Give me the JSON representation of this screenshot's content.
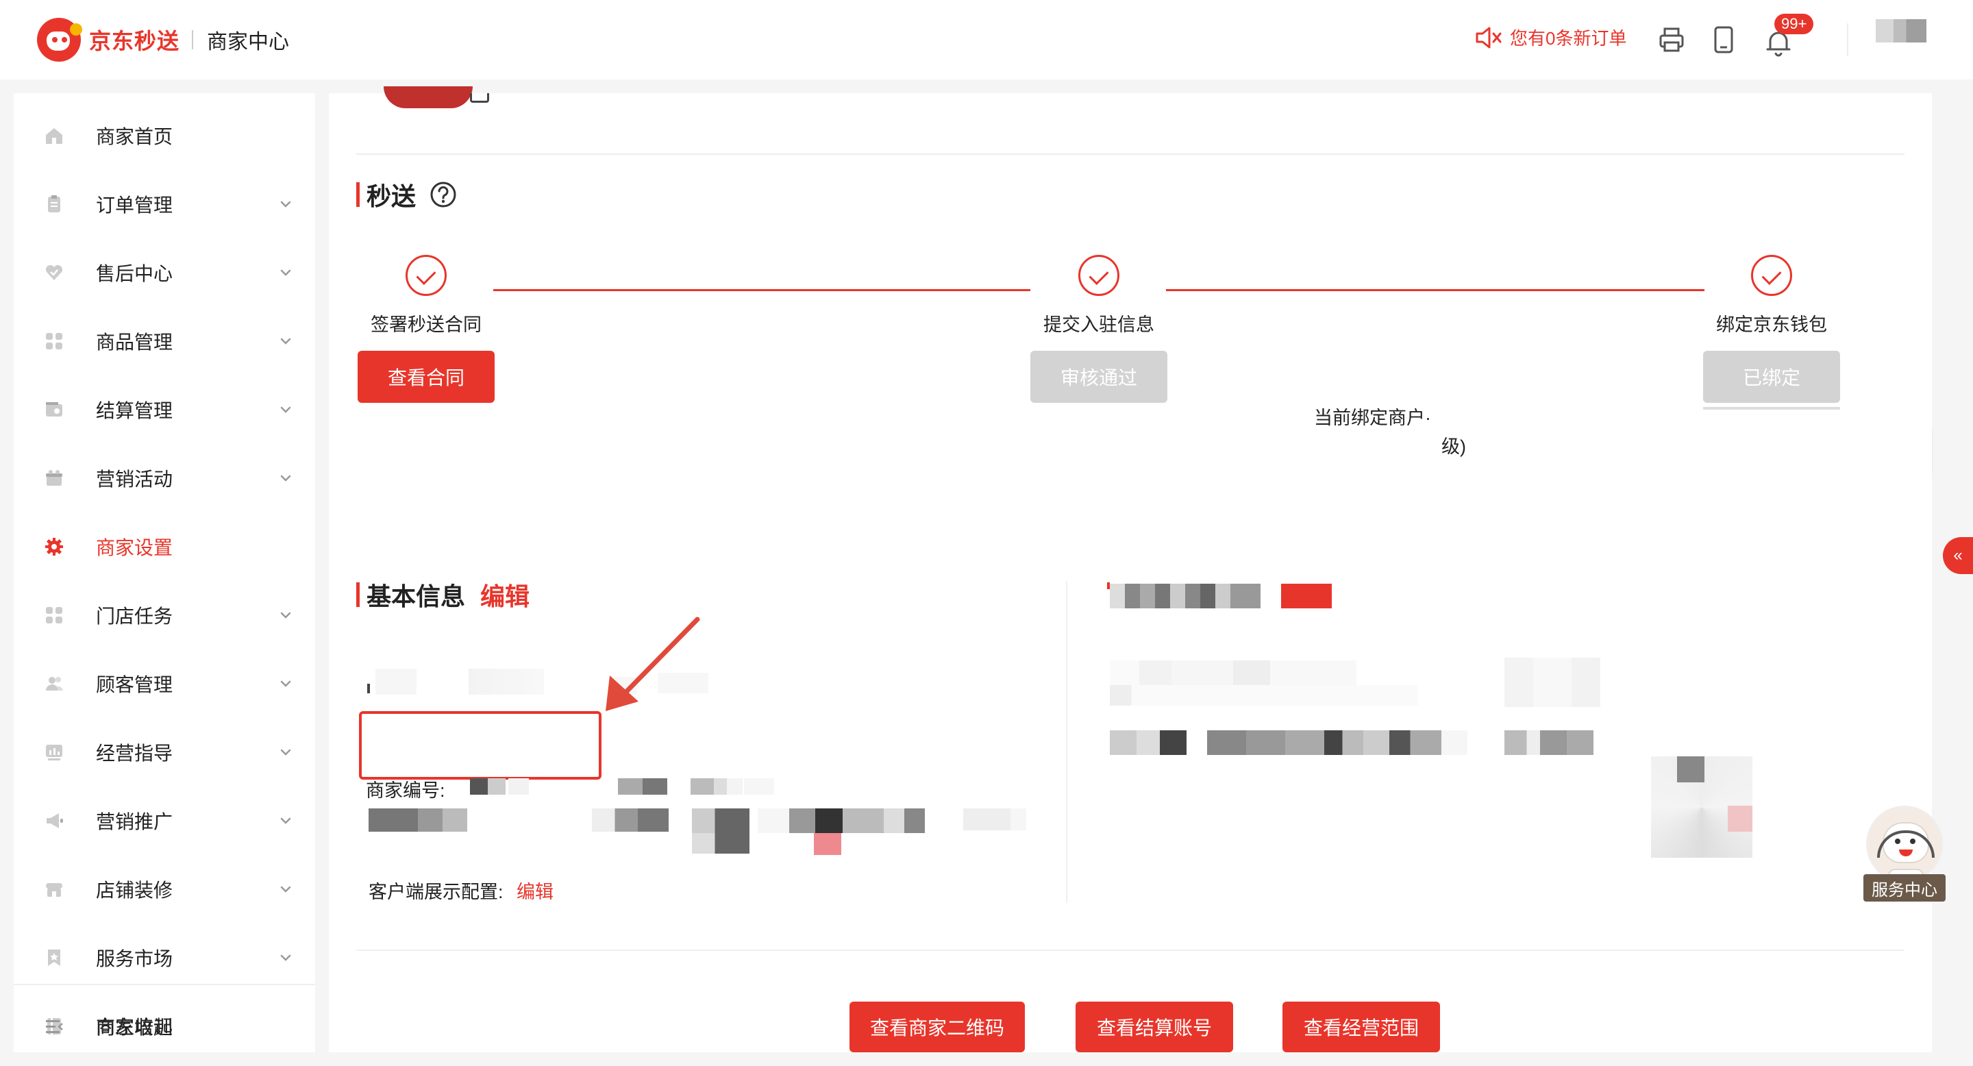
{
  "header": {
    "brand": "京东秒送",
    "subtitle": "商家中心",
    "order_alert": "您有0条新订单",
    "notification_badge": "99+"
  },
  "sidebar": {
    "items": [
      {
        "label": "商家首页",
        "icon": "home-icon",
        "expandable": false,
        "active": false
      },
      {
        "label": "订单管理",
        "icon": "clipboard-icon",
        "expandable": true,
        "active": false
      },
      {
        "label": "售后中心",
        "icon": "heart-icon",
        "expandable": true,
        "active": false
      },
      {
        "label": "商品管理",
        "icon": "grid-icon",
        "expandable": true,
        "active": false
      },
      {
        "label": "结算管理",
        "icon": "wallet-icon",
        "expandable": true,
        "active": false
      },
      {
        "label": "营销活动",
        "icon": "gift-icon",
        "expandable": true,
        "active": false
      },
      {
        "label": "商家设置",
        "icon": "gear-icon",
        "expandable": false,
        "active": true
      },
      {
        "label": "门店任务",
        "icon": "grid-icon",
        "expandable": true,
        "active": false
      },
      {
        "label": "顾客管理",
        "icon": "users-icon",
        "expandable": true,
        "active": false
      },
      {
        "label": "经营指导",
        "icon": "chart-icon",
        "expandable": true,
        "active": false
      },
      {
        "label": "营销推广",
        "icon": "megaphone-icon",
        "expandable": true,
        "active": false
      },
      {
        "label": "店铺装修",
        "icon": "store-icon",
        "expandable": true,
        "active": false
      },
      {
        "label": "服务市场",
        "icon": "bookmark-icon",
        "expandable": true,
        "active": false
      },
      {
        "label": "商家培训",
        "icon": "book-icon",
        "expandable": false,
        "active": false
      }
    ],
    "collapse_label": "向左收起"
  },
  "miaosong": {
    "title": "秒送",
    "steps": [
      {
        "label": "签署秒送合同",
        "button": "查看合同",
        "style": "primary"
      },
      {
        "label": "提交入驻信息",
        "button": "审核通过",
        "style": "disabled"
      },
      {
        "label": "绑定京东钱包",
        "button": "已绑定",
        "style": "disabled"
      }
    ],
    "wallet_note_1": "当前绑定商户·",
    "wallet_note_2": "级)"
  },
  "basic_info": {
    "title": "基本信息",
    "edit": "编辑",
    "merchant_id_label": "商家编号:",
    "client_display_label": "客户端展示配置:",
    "client_display_edit": "编辑"
  },
  "bottom_buttons": [
    "查看商家二维码",
    "查看结算账号",
    "查看经营范围"
  ],
  "service": {
    "label": "服务中心"
  },
  "colors": {
    "accent": "#e8352b",
    "disabled": "#d3d3d3"
  }
}
